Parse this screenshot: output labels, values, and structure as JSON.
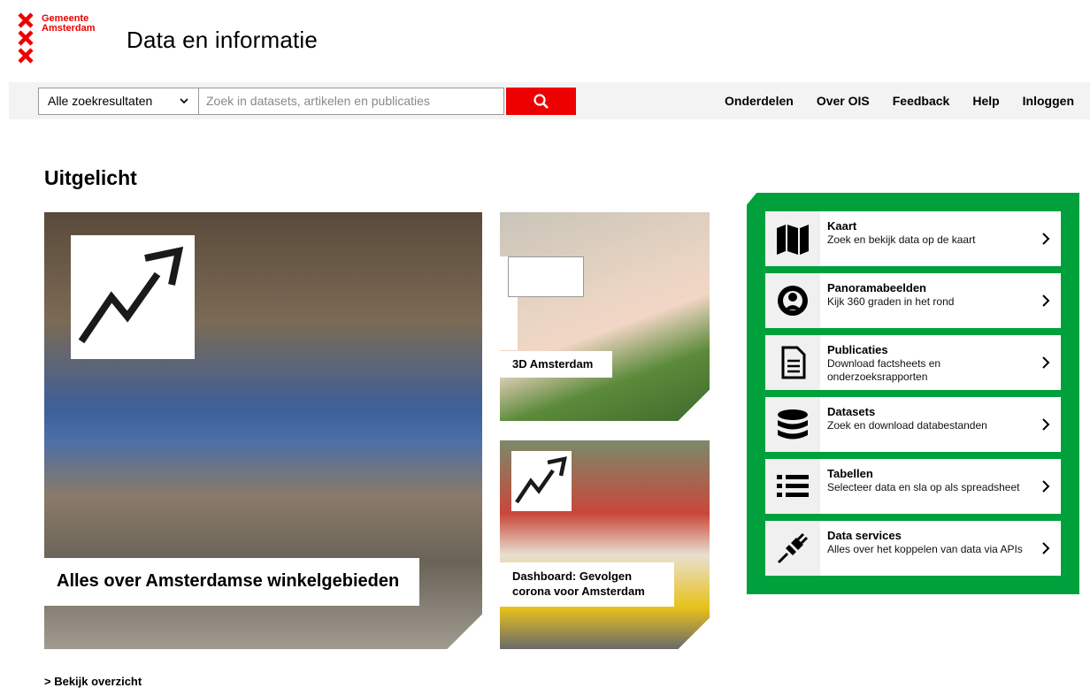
{
  "header": {
    "logo_text": "Gemeente\nAmsterdam",
    "title": "Data en informatie"
  },
  "search": {
    "scope_value": "Alle zoekresultaten",
    "placeholder": "Zoek in datasets, artikelen en publicaties"
  },
  "nav": {
    "items": [
      "Onderdelen",
      "Over OIS",
      "Feedback",
      "Help",
      "Inloggen"
    ]
  },
  "featured": {
    "title": "Uitgelicht",
    "main_label": "Alles over Amsterdamse winkelgebieden",
    "tile_3d_label": "3D Amsterdam",
    "tile_corona_label": "Dashboard: Gevolgen corona voor Amsterdam",
    "overview_link": "> Bekijk overzicht"
  },
  "side": {
    "items": [
      {
        "title": "Kaart",
        "desc": "Zoek en bekijk data op de kaart",
        "icon": "map-icon"
      },
      {
        "title": "Panoramabeelden",
        "desc": "Kijk 360 graden in het rond",
        "icon": "panorama-icon"
      },
      {
        "title": "Publicaties",
        "desc": "Download factsheets en onderzoeksrapporten",
        "icon": "document-icon"
      },
      {
        "title": "Datasets",
        "desc": "Zoek en download databestanden",
        "icon": "database-icon"
      },
      {
        "title": "Tabellen",
        "desc": "Selecteer data en sla op als spreadsheet",
        "icon": "list-icon"
      },
      {
        "title": "Data services",
        "desc": "Alles over het koppelen van data via APIs",
        "icon": "plug-icon"
      }
    ]
  },
  "colors": {
    "brand_red": "#ec0000",
    "panel_green": "#00a03c"
  }
}
